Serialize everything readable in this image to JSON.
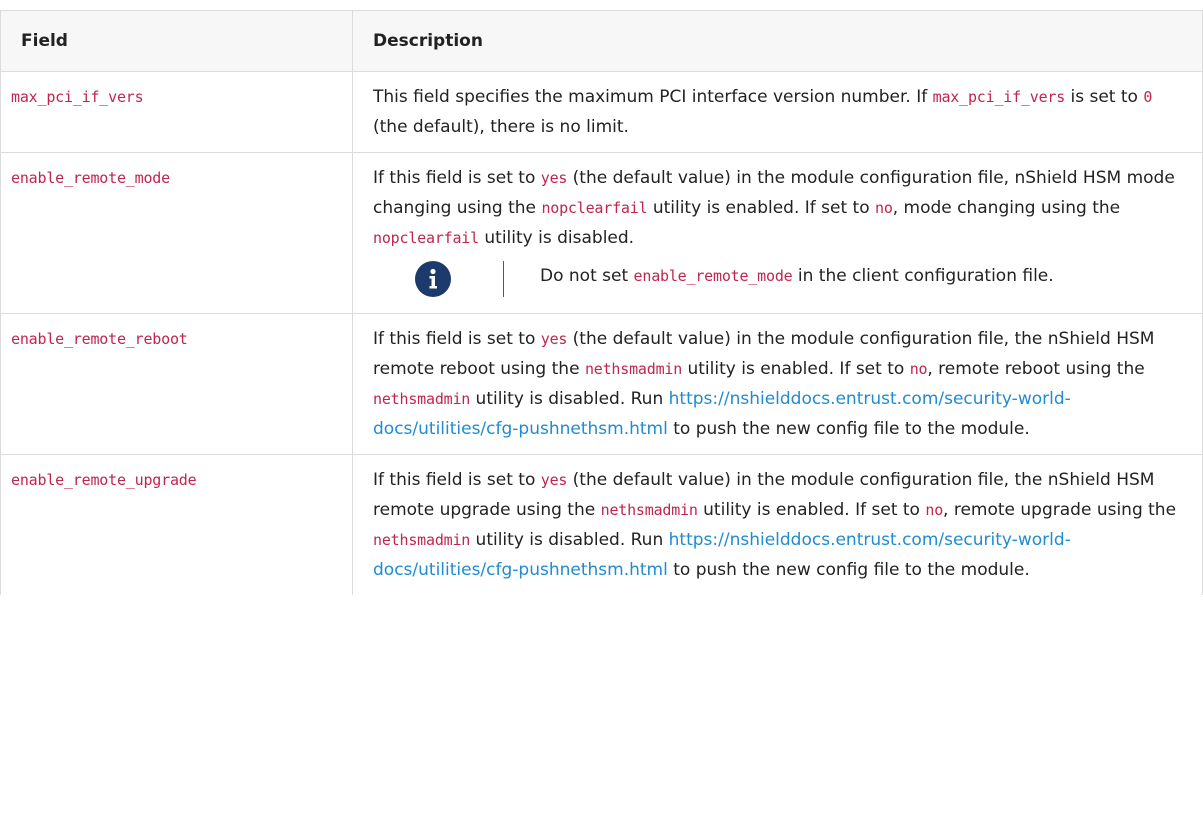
{
  "header": {
    "field_label": "Field",
    "description_label": "Description"
  },
  "rows": [
    {
      "field": "max_pci_if_vers",
      "desc": {
        "t1": "This field specifies the maximum PCI interface version number. If ",
        "c1": "max_pci_if_vers",
        "t2": " is set to ",
        "c2": "0",
        "t3": " (the default), there is no limit."
      }
    },
    {
      "field": "enable_remote_mode",
      "desc": {
        "t1": "If this field is set to ",
        "c1": "yes",
        "t2": " (the default value) in the module configuration file, nShield HSM mode changing using the ",
        "c2": "nopclearfail",
        "t3": " utility is enabled. If set to ",
        "c3": "no",
        "t4": ", mode changing using the ",
        "c4": "nopclearfail",
        "t5": " utility is disabled."
      },
      "note": {
        "icon": "info-icon",
        "t1": "Do not set ",
        "c1": "enable_remote_mode",
        "t2": " in the client configuration file."
      }
    },
    {
      "field": "enable_remote_reboot",
      "desc": {
        "t1": "If this field is set to ",
        "c1": "yes",
        "t2": " (the default value) in the module configuration file, the nShield HSM remote reboot using the ",
        "c2": "nethsmadmin",
        "t3": " utility is enabled. If set to ",
        "c3": "no",
        "t4": ", remote reboot using the ",
        "c4": "nethsmadmin",
        "t5": " utility is disabled. Run ",
        "link": "https://nshielddocs.entrust.com/security-world-docs/utilities/cfg-pushnethsm.html",
        "t6": " to push the new config file to the module."
      }
    },
    {
      "field": "enable_remote_upgrade",
      "desc": {
        "t1": "If this field is set to ",
        "c1": "yes",
        "t2": " (the default value) in the module configuration file, the nShield HSM remote upgrade using the ",
        "c2": "nethsmadmin",
        "t3": " utility is enabled. If set to ",
        "c3": "no",
        "t4": ", remote upgrade using the ",
        "c4": "nethsmadmin",
        "t5": " utility is disabled. Run ",
        "link": "https://nshielddocs.entrust.com/security-world-docs/utilities/cfg-pushnethsm.html",
        "t6": " to push the new config file to the module."
      }
    }
  ],
  "colors": {
    "code": "#c0254f",
    "link": "#1f8bd1",
    "icon_bg": "#1c3a6b",
    "note_rule": "#8a3a66"
  }
}
